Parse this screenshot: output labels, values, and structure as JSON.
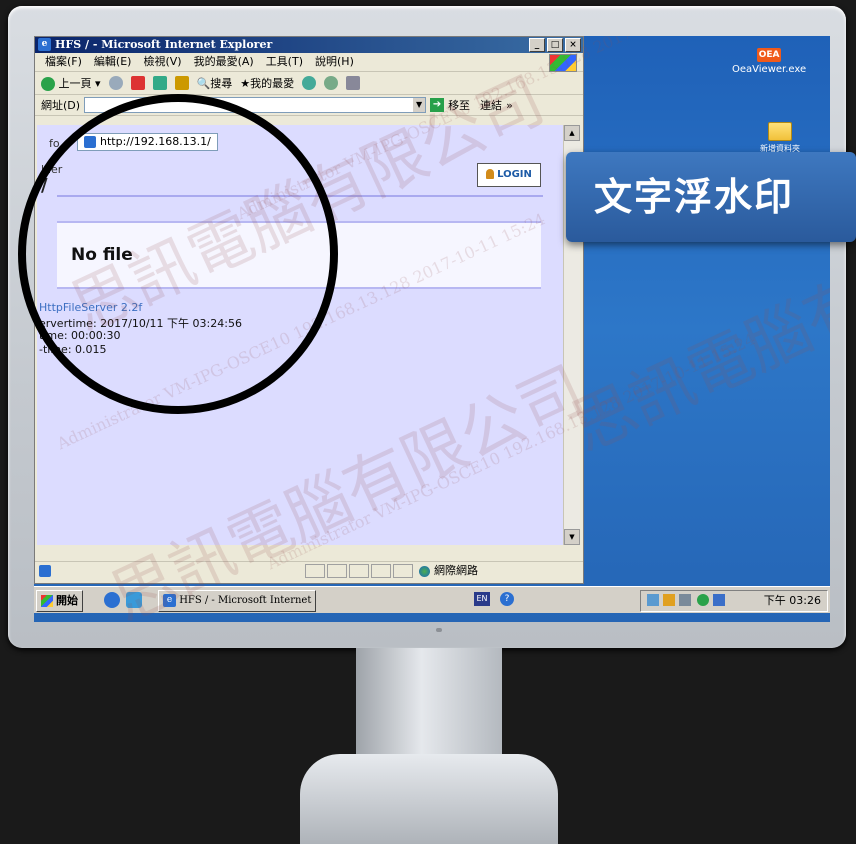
{
  "ie_window": {
    "title": "HFS / - Microsoft Internet Explorer",
    "menu": [
      "檔案(F)",
      "編輯(E)",
      "檢視(V)",
      "我的最愛(A)",
      "工具(T)",
      "說明(H)"
    ],
    "toolbar": {
      "back_label": "上一頁",
      "search_label": "搜尋",
      "favorites_label": "我的最愛"
    },
    "address": {
      "label": "網址(D)",
      "go_label": "移至",
      "links_label": "連結",
      "links_chevron": "»",
      "url": "http://192.168.13.1/"
    },
    "window_buttons": [
      "_",
      "□",
      "×"
    ],
    "status": {
      "zone": "網際網路"
    }
  },
  "hfs_page": {
    "fo_text": "fo",
    "folder_label": "lder",
    "path": "/",
    "login_label": "LOGIN",
    "no_file": "No file",
    "server_link": "HttpFileServer 2.2f",
    "servertime": "ervertime: 2017/10/11 下午 03:24:56",
    "uptime": "time: 00:00:30",
    "buildtime": "-time: 0.015"
  },
  "desktop": {
    "icons": [
      {
        "label": "OeaViewer.exe",
        "logo": "OEA"
      },
      {
        "label": "新增資料夾"
      }
    ]
  },
  "taskbar": {
    "start_label": "開始",
    "task_button": "HFS / - Microsoft Internet ...",
    "lang": "EN",
    "help_glyph": "?",
    "clock": "下午 03:26"
  },
  "callout": {
    "text": "文字浮水印"
  },
  "watermark": {
    "company": "思訊電腦有限公司",
    "id_line": "Administrator VM-IPG-OSCE10 192.168.13.128 2017-10-11 15:24"
  },
  "colors": {
    "hfs_background": "#dcdcff",
    "desktop_blue": "#2d77c8",
    "callout_blue": "#3e78c0",
    "titlebar": "#0a246a"
  }
}
